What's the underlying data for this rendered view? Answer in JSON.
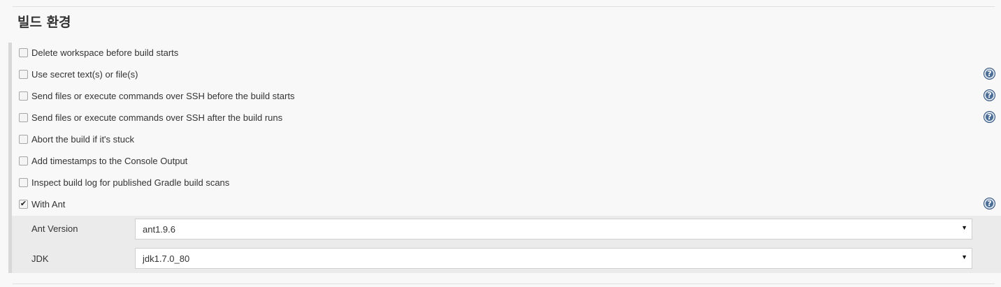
{
  "section": {
    "title": "빌드 환경"
  },
  "options": [
    {
      "label": "Delete workspace before build starts",
      "checked": false,
      "help": false
    },
    {
      "label": "Use secret text(s) or file(s)",
      "checked": false,
      "help": true
    },
    {
      "label": "Send files or execute commands over SSH before the build starts",
      "checked": false,
      "help": true
    },
    {
      "label": "Send files or execute commands over SSH after the build runs",
      "checked": false,
      "help": true
    },
    {
      "label": "Abort the build if it's stuck",
      "checked": false,
      "help": false
    },
    {
      "label": "Add timestamps to the Console Output",
      "checked": false,
      "help": false
    },
    {
      "label": "Inspect build log for published Gradle build scans",
      "checked": false,
      "help": false
    },
    {
      "label": "With Ant",
      "checked": true,
      "help": true
    }
  ],
  "ant": {
    "version_label": "Ant Version",
    "version_value": "ant1.9.6",
    "jdk_label": "JDK",
    "jdk_value": "jdk1.7.0_80"
  },
  "icons": {
    "help": "help-icon",
    "dropdown": "dropdown-arrow-icon",
    "checkmark": "checkmark-icon"
  },
  "glyphs": {
    "help": "?",
    "check": "✔",
    "arrow": "▼"
  },
  "colors": {
    "help_icon": "#4c6e96",
    "config_background": "#ebebeb",
    "page_background": "#f8f8f8"
  }
}
